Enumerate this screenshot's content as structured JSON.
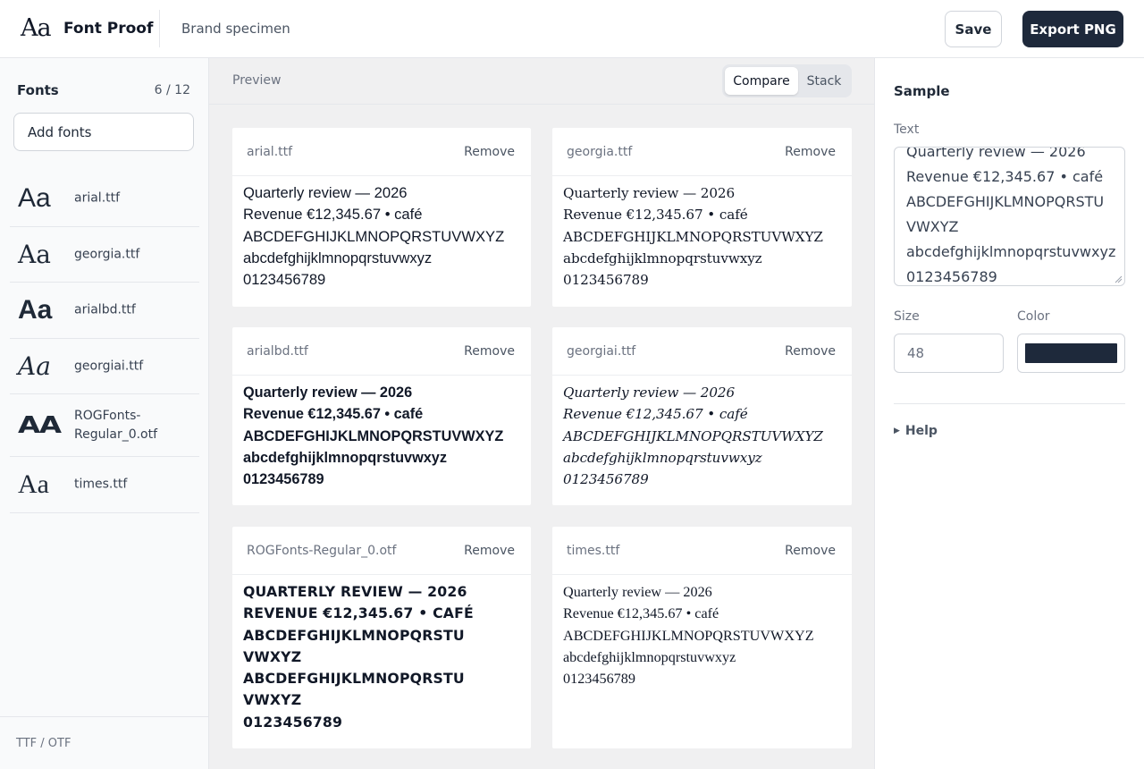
{
  "header": {
    "logo_glyph": "Aa",
    "app_name": "Font Proof",
    "project_name": "Brand specimen",
    "save_label": "Save",
    "export_label": "Export PNG"
  },
  "sidebar": {
    "title": "Fonts",
    "count": "6 / 12",
    "add_label": "Add fonts",
    "footer": "TTF / OTF",
    "fonts": [
      {
        "glyph": "Aa",
        "name": "arial.ttf"
      },
      {
        "glyph": "Aa",
        "name": "georgia.ttf"
      },
      {
        "glyph": "Aa",
        "name": "arialbd.ttf"
      },
      {
        "glyph": "Aa",
        "name": "georgiai.ttf"
      },
      {
        "glyph": "AA",
        "name": "ROGFonts-Regular_0.otf"
      },
      {
        "glyph": "Aa",
        "name": "times.ttf"
      }
    ]
  },
  "preview": {
    "label": "Preview",
    "modes": [
      "Compare",
      "Stack"
    ],
    "active_mode": "Compare",
    "remove_label": "Remove",
    "cards": [
      {
        "file": "arial.ttf",
        "lines": [
          "Quarterly review — 2026",
          "Revenue €12,345.67 • café",
          "ABCDEFGHIJKLMNOPQRSTUVWXYZ",
          "abcdefghijklmnopqrstuvwxyz",
          "0123456789"
        ]
      },
      {
        "file": "georgia.ttf",
        "lines": [
          "Quarterly review — 2026",
          "Revenue €12,345.67 • café",
          "ABCDEFGHIJKLMNOPQRSTUVWXYZ",
          "abcdefghijklmnopqrstuvwxyz",
          "0123456789"
        ]
      },
      {
        "file": "arialbd.ttf",
        "lines": [
          "Quarterly review — 2026",
          "Revenue €12,345.67 • café",
          "ABCDEFGHIJKLMNOPQRSTUVWXYZ",
          "abcdefghijklmnopqrstuvwxyz",
          "0123456789"
        ]
      },
      {
        "file": "georgiai.ttf",
        "lines": [
          "Quarterly review — 2026",
          "Revenue €12,345.67 • café",
          "ABCDEFGHIJKLMNOPQRSTUVWXYZ",
          "abcdefghijklmnopqrstuvwxyz",
          "0123456789"
        ]
      },
      {
        "file": "ROGFonts-Regular_0.otf",
        "lines": [
          "QUARTERLY REVIEW — 2026",
          "REVENUE €12,345.67 • CAFé",
          "ABCDEFGHIJKLMNOPQRSTU VWXYZ",
          "ABCDEFGHIJKLMNOPQRSTU VWXYZ",
          "0123456789"
        ]
      },
      {
        "file": "times.ttf",
        "lines": [
          "Quarterly review — 2026",
          "Revenue €12,345.67 • café",
          "ABCDEFGHIJKLMNOPQRSTUVWXYZ",
          "abcdefghijklmnopqrstuvwxyz",
          "0123456789"
        ]
      }
    ]
  },
  "panel": {
    "title": "Sample",
    "text_label": "Text",
    "sample_text": "Quarterly review — 2026\nRevenue €12,345.67 • café\nABCDEFGHIJKLMNOPQRSTU\nVWXYZ\nabcdefghijklmnopqrstuvwxyz\n0123456789",
    "size_label": "Size",
    "size_value": "48",
    "color_label": "Color",
    "color_value": "#1e293b",
    "help_label": "Help"
  }
}
